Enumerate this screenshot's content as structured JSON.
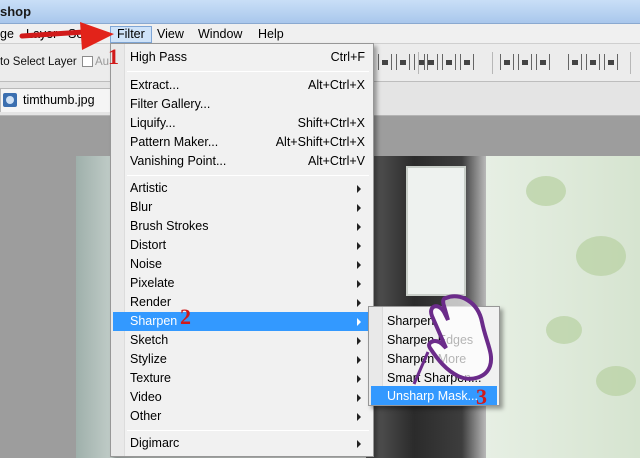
{
  "window": {
    "title_fragment": "shop"
  },
  "menubar": {
    "items": [
      {
        "label": "ge"
      },
      {
        "label": "Layer"
      },
      {
        "label": "Se"
      },
      {
        "label": "Filter"
      },
      {
        "label": "View"
      },
      {
        "label": "Window"
      },
      {
        "label": "Help"
      }
    ]
  },
  "options": {
    "auto_select_label": "to Select Layer",
    "auto_label": "Au"
  },
  "document": {
    "tab_name": "timthumb.jpg"
  },
  "filter_menu": {
    "items": [
      {
        "label": "High Pass",
        "shortcut": "Ctrl+F"
      },
      {
        "label": "Extract...",
        "shortcut": "Alt+Ctrl+X"
      },
      {
        "label": "Filter Gallery..."
      },
      {
        "label": "Liquify...",
        "shortcut": "Shift+Ctrl+X"
      },
      {
        "label": "Pattern Maker...",
        "shortcut": "Alt+Shift+Ctrl+X"
      },
      {
        "label": "Vanishing Point...",
        "shortcut": "Alt+Ctrl+V"
      },
      {
        "label": "Artistic"
      },
      {
        "label": "Blur"
      },
      {
        "label": "Brush Strokes"
      },
      {
        "label": "Distort"
      },
      {
        "label": "Noise"
      },
      {
        "label": "Pixelate"
      },
      {
        "label": "Render"
      },
      {
        "label": "Sharpen"
      },
      {
        "label": "Sketch"
      },
      {
        "label": "Stylize"
      },
      {
        "label": "Texture"
      },
      {
        "label": "Video"
      },
      {
        "label": "Other"
      },
      {
        "label": "Digimarc"
      }
    ]
  },
  "sharpen_submenu": {
    "items": [
      {
        "label": "Sharpen"
      },
      {
        "label": "Sharpen Edges"
      },
      {
        "label": "Sharpen More"
      },
      {
        "label": "Smart Sharpen..."
      },
      {
        "label": "Unsharp Mask..."
      }
    ]
  },
  "annotations": {
    "step1": "1",
    "step2": "2",
    "step3": "3"
  },
  "colors": {
    "highlight": "#3399ff",
    "annotation_red": "#d11a1a"
  }
}
